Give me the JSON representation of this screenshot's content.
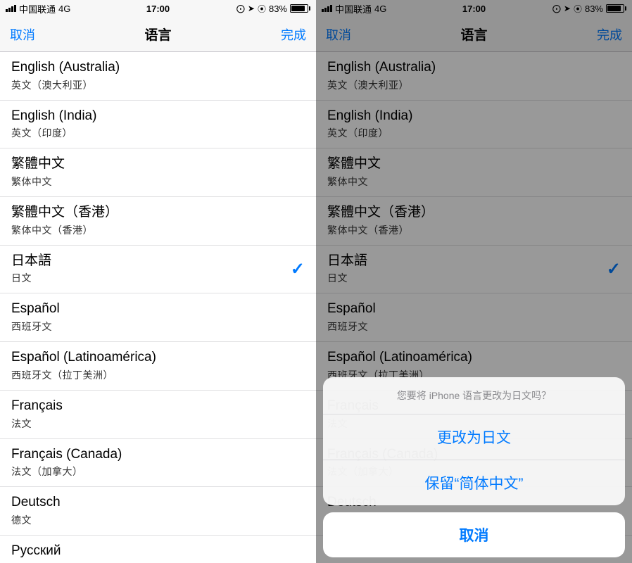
{
  "statusbar": {
    "carrier": "中国联通",
    "network": "4G",
    "time": "17:00",
    "battery_pct": "83%",
    "lock_icon": "⊙",
    "location_icon": "➤",
    "alarm_icon": "⏰"
  },
  "navbar": {
    "cancel": "取消",
    "title": "语言",
    "done": "完成"
  },
  "languages": [
    {
      "main": "English (Australia)",
      "sub": "英文（澳大利亚）",
      "selected": false
    },
    {
      "main": "English (India)",
      "sub": "英文（印度）",
      "selected": false
    },
    {
      "main": "繁體中文",
      "sub": "繁体中文",
      "selected": false
    },
    {
      "main": "繁體中文（香港）",
      "sub": "繁体中文（香港）",
      "selected": false
    },
    {
      "main": "日本語",
      "sub": "日文",
      "selected": true
    },
    {
      "main": "Español",
      "sub": "西班牙文",
      "selected": false
    },
    {
      "main": "Español (Latinoamérica)",
      "sub": "西班牙文（拉丁美洲）",
      "selected": false
    },
    {
      "main": "Français",
      "sub": "法文",
      "selected": false
    },
    {
      "main": "Français (Canada)",
      "sub": "法文（加拿大）",
      "selected": false
    },
    {
      "main": "Deutsch",
      "sub": "德文",
      "selected": false
    },
    {
      "main": "Русский",
      "sub": "",
      "selected": false
    }
  ],
  "actionsheet": {
    "message": "您要将 iPhone 语言更改为日文吗？",
    "change": "更改为日文",
    "keep": "保留“简体中文”",
    "cancel": "取消"
  }
}
